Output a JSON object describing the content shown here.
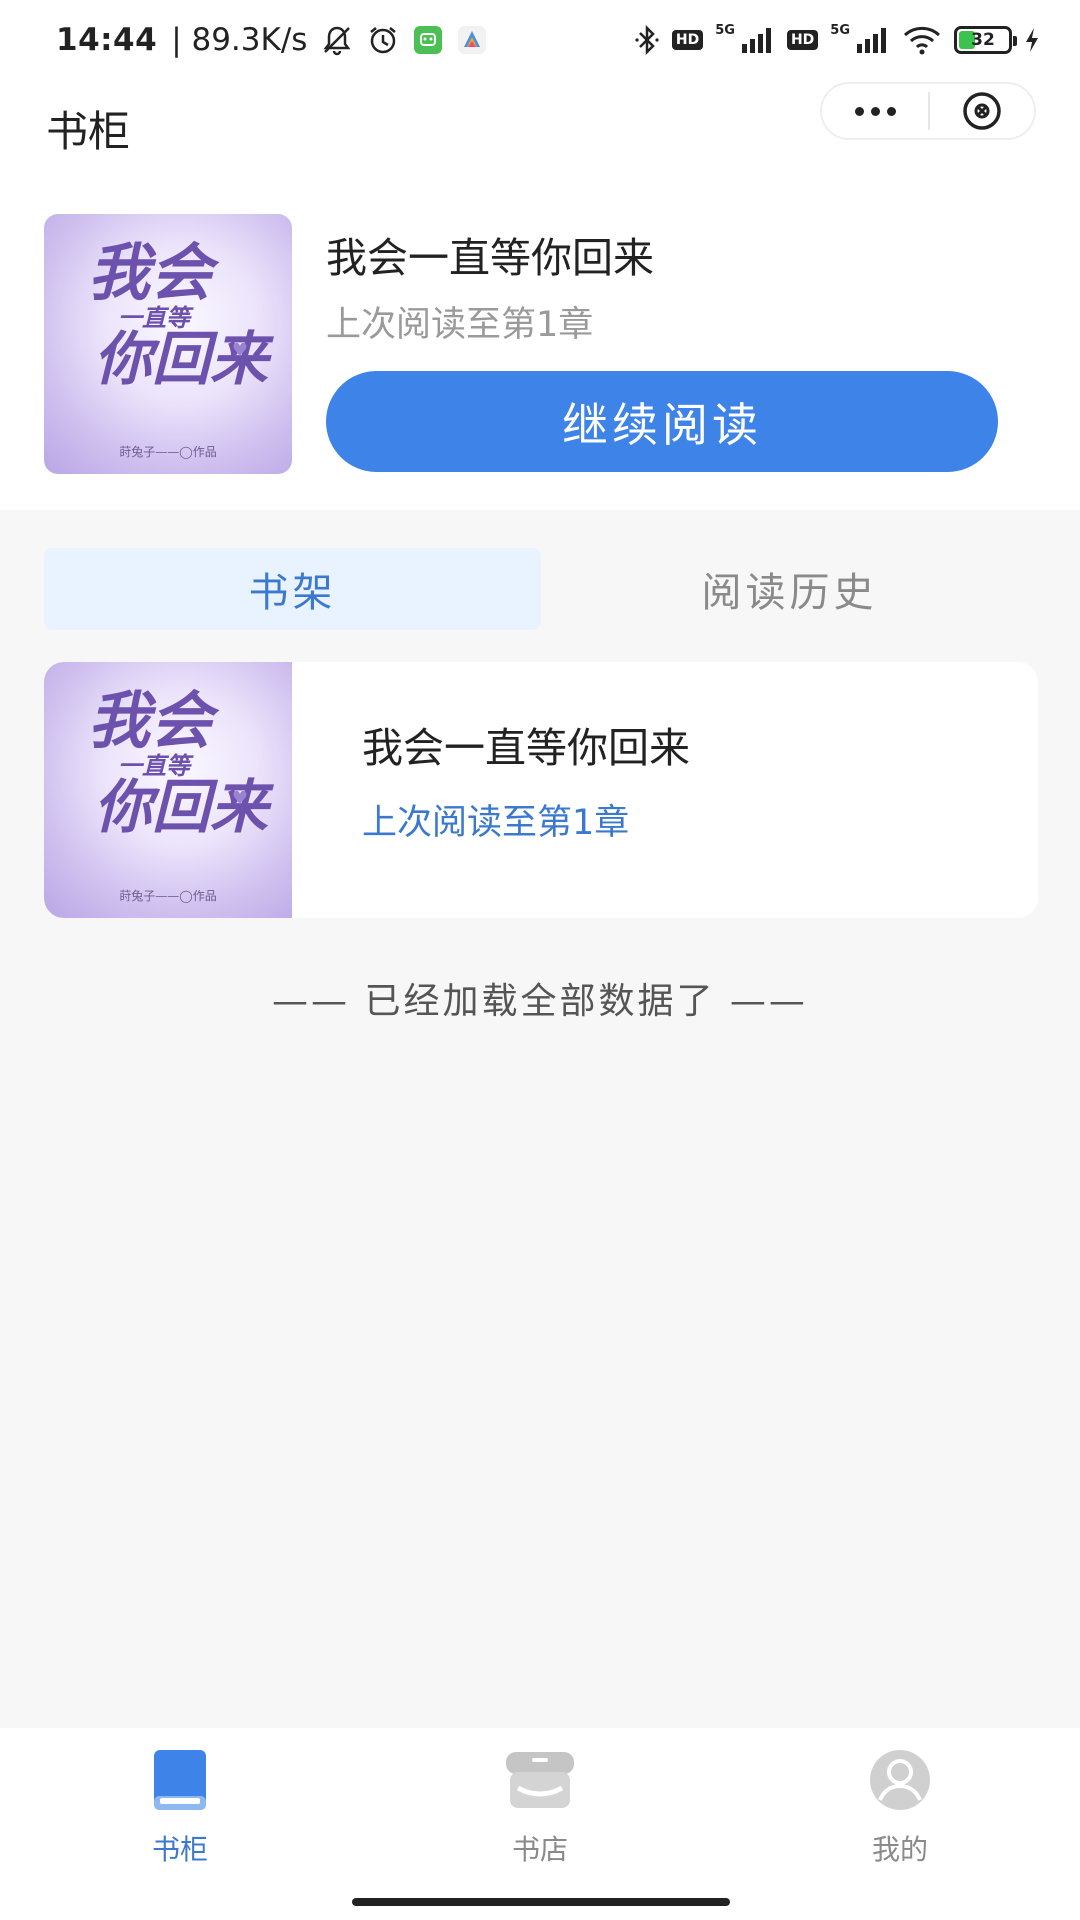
{
  "status_bar": {
    "time": "14:44",
    "speed": "| 89.3K/s",
    "signal_label_1": "5G",
    "signal_label_2": "5G",
    "hd_label_1": "HD",
    "hd_label_2": "HD",
    "battery": "32",
    "icons": [
      "mute-bell-icon",
      "alarm-icon",
      "app-icon",
      "app-icon-2",
      "bluetooth-icon",
      "signal-icon",
      "wifi-icon",
      "battery-icon",
      "charging-icon"
    ]
  },
  "header": {
    "title": "书柜",
    "more_icon": "more-icon",
    "close_icon": "close-icon"
  },
  "continue_reading": {
    "cover_art": {
      "line1": "我会",
      "line2": "一直等",
      "line3": "你回来",
      "author": "莳兔子——◯作品"
    },
    "book_title": "我会一直等你回来",
    "progress": "上次阅读至第1章",
    "button_label": "继续阅读"
  },
  "tabs": [
    {
      "label": "书架",
      "active": true
    },
    {
      "label": "阅读历史",
      "active": false
    }
  ],
  "shelf": {
    "items": [
      {
        "cover_art": {
          "line1": "我会",
          "line2": "一直等",
          "line3": "你回来",
          "author": "莳兔子——◯作品"
        },
        "title": "我会一直等你回来",
        "progress": "上次阅读至第1章"
      }
    ],
    "end_text": "—— 已经加载全部数据了 ——"
  },
  "bottom_nav": [
    {
      "label": "书柜",
      "icon": "book-icon",
      "active": true
    },
    {
      "label": "书店",
      "icon": "store-icon",
      "active": false
    },
    {
      "label": "我的",
      "icon": "user-icon",
      "active": false
    }
  ],
  "colors": {
    "primary": "#3e83e8",
    "tab_active_bg": "#e8f3ff",
    "tab_active_text": "#3b79cf",
    "page_bg": "#f7f7f7",
    "muted_text": "#9a9a9a"
  }
}
